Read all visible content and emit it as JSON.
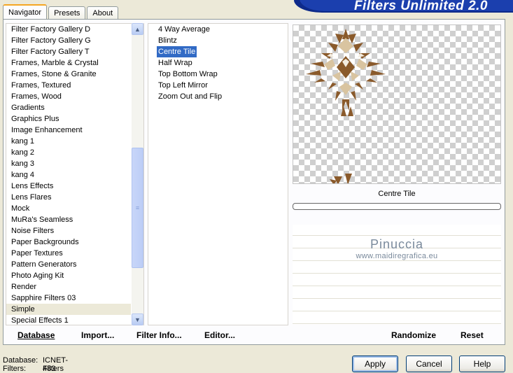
{
  "app": {
    "title": "Filters Unlimited 2.0"
  },
  "tabs": [
    {
      "label": "Navigator",
      "active": true
    },
    {
      "label": "Presets",
      "active": false
    },
    {
      "label": "About",
      "active": false
    }
  ],
  "categories": {
    "selected": "Simple",
    "items": [
      "Filter Factory Gallery D",
      "Filter Factory Gallery G",
      "Filter Factory Gallery T",
      "Frames, Marble & Crystal",
      "Frames, Stone & Granite",
      "Frames, Textured",
      "Frames, Wood",
      "Gradients",
      "Graphics Plus",
      "Image Enhancement",
      "kang 1",
      "kang 2",
      "kang 3",
      "kang 4",
      "Lens Effects",
      "Lens Flares",
      "Mock",
      "MuRa's Seamless",
      "Noise Filters",
      "Paper Backgrounds",
      "Paper Textures",
      "Pattern Generators",
      "Photo Aging Kit",
      "Render",
      "Sapphire Filters 03",
      "Simple",
      "Special Effects 1"
    ],
    "scroll_position": 0.52
  },
  "filters": {
    "selected": "Centre Tile",
    "items": [
      "4 Way Average",
      "Blintz",
      "Centre Tile",
      "Half Wrap",
      "Top Bottom Wrap",
      "Top Left Mirror",
      "Zoom Out and Flip"
    ]
  },
  "preview": {
    "filter_name": "Centre Tile",
    "progress": 0
  },
  "watermark": {
    "name": "Pinuccia",
    "url": "www.maidiregrafica.eu"
  },
  "toolbar": {
    "database": "Database",
    "import": "Import...",
    "filter_info": "Filter Info...",
    "editor": "Editor...",
    "randomize": "Randomize",
    "reset": "Reset"
  },
  "status": {
    "database_label": "Database:",
    "database_value": "ICNET-Filters",
    "filters_label": "Filters:",
    "filters_value": "483"
  },
  "buttons": {
    "apply": "Apply",
    "cancel": "Cancel",
    "help": "Help"
  },
  "colors": {
    "selection": "#316ac5",
    "banner": "#0d2a8a",
    "active_tab_accent": "#f5a622"
  }
}
